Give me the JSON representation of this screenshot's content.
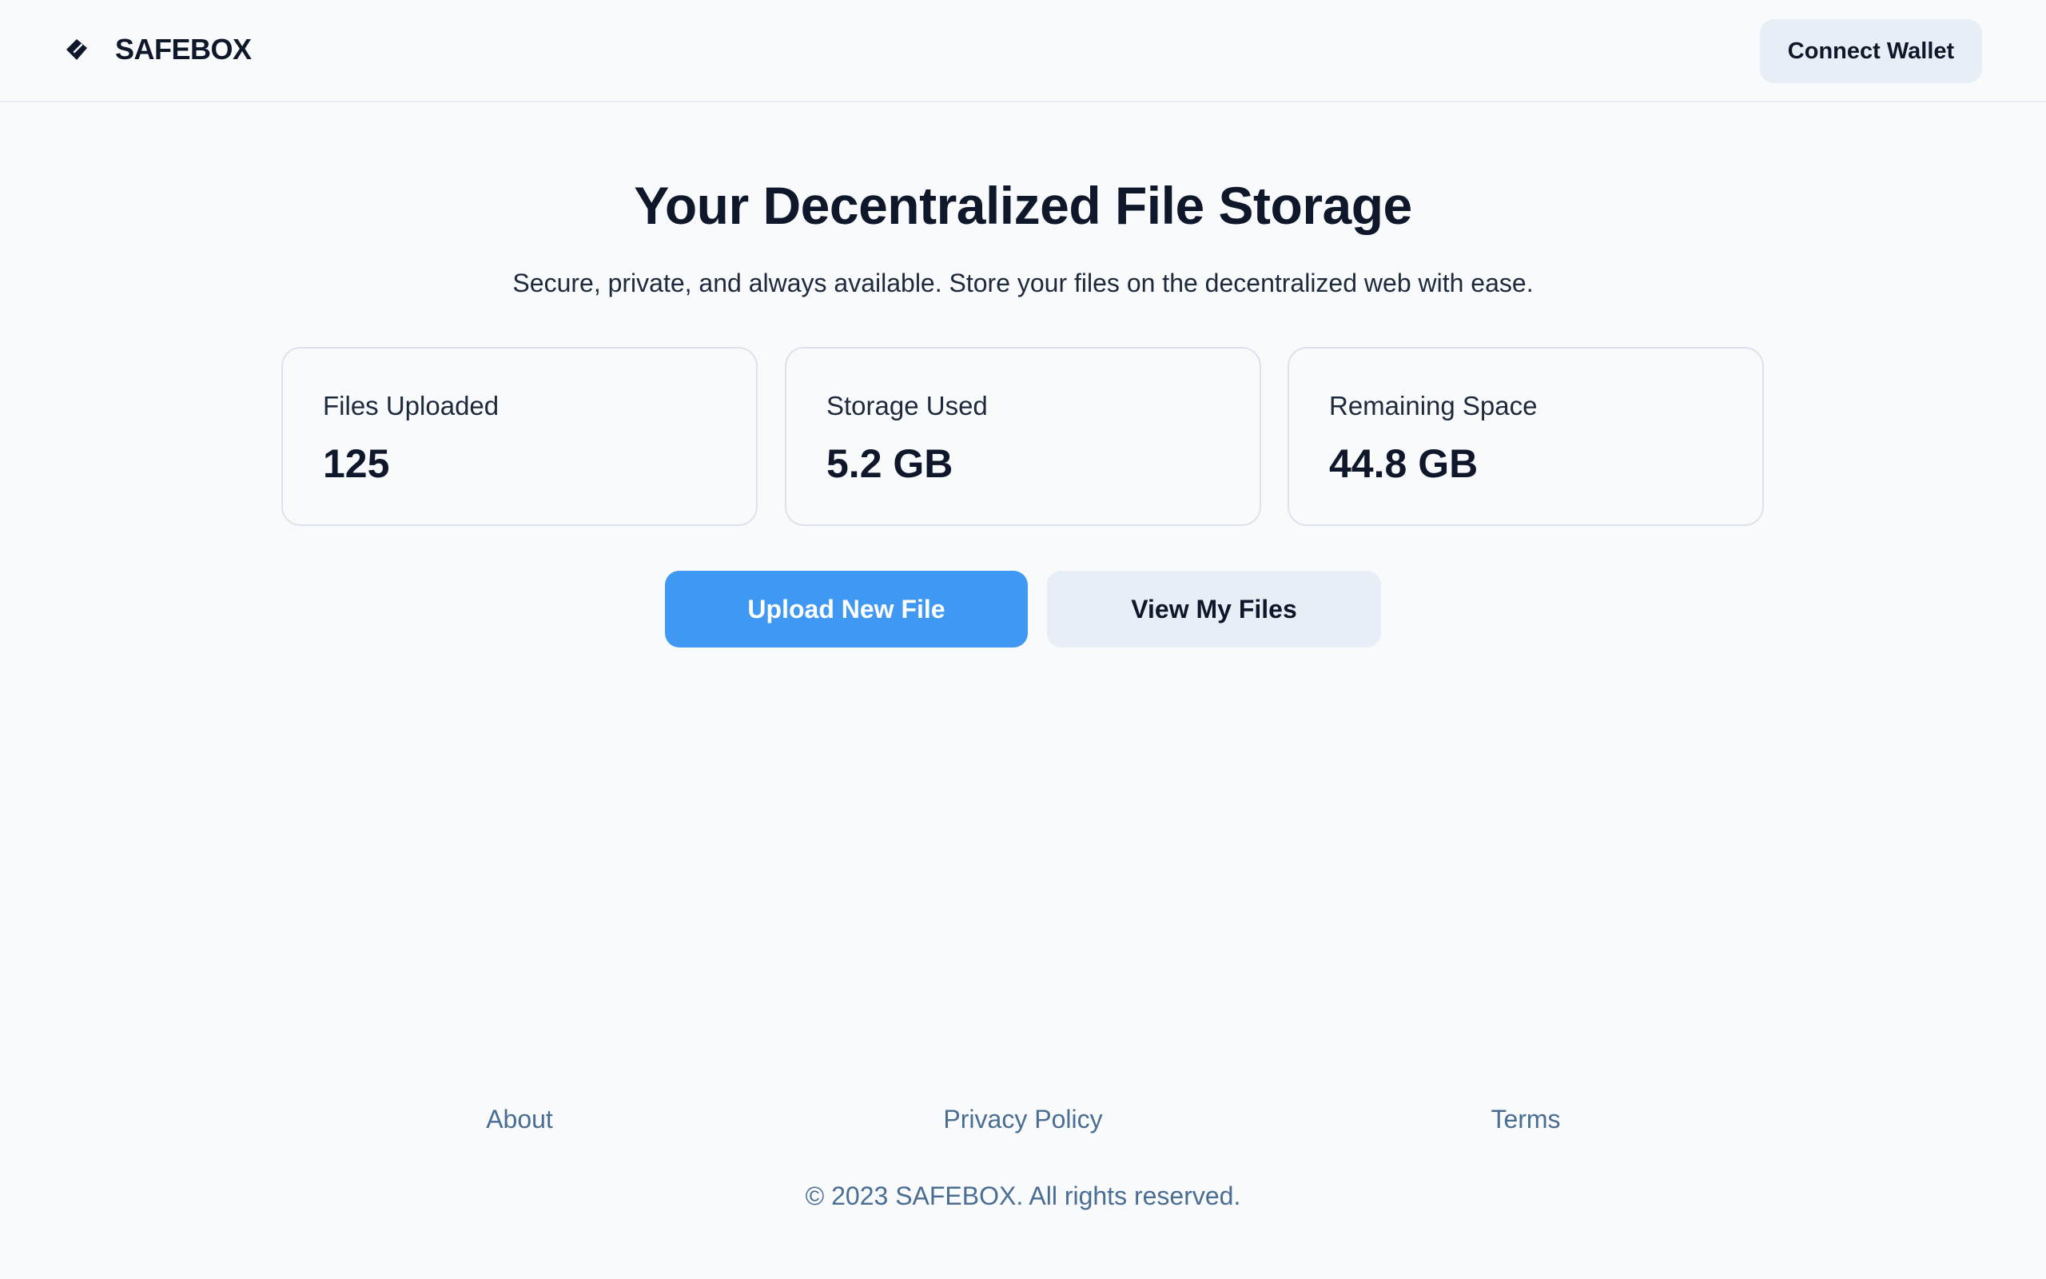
{
  "header": {
    "brand_name": "SAFEBOX",
    "brand_icon": "tag-icon",
    "connect_label": "Connect Wallet"
  },
  "hero": {
    "title": "Your Decentralized File Storage",
    "subtitle": "Secure, private, and always available. Store your files on the decentralized web with ease."
  },
  "stats": [
    {
      "label": "Files Uploaded",
      "value": "125"
    },
    {
      "label": "Storage Used",
      "value": "5.2 GB"
    },
    {
      "label": "Remaining Space",
      "value": "44.8 GB"
    }
  ],
  "actions": {
    "upload_label": "Upload New File",
    "view_label": "View My Files"
  },
  "footer": {
    "links": [
      {
        "label": "About"
      },
      {
        "label": "Privacy Policy"
      },
      {
        "label": "Terms"
      }
    ],
    "copyright": "© 2023 SAFEBOX. All rights reserved."
  },
  "colors": {
    "background": "#f8fafc",
    "primary": "#3f99f2",
    "secondary_button": "#e8eef6",
    "footer_text": "#4a6e93",
    "text": "#0f172a"
  }
}
